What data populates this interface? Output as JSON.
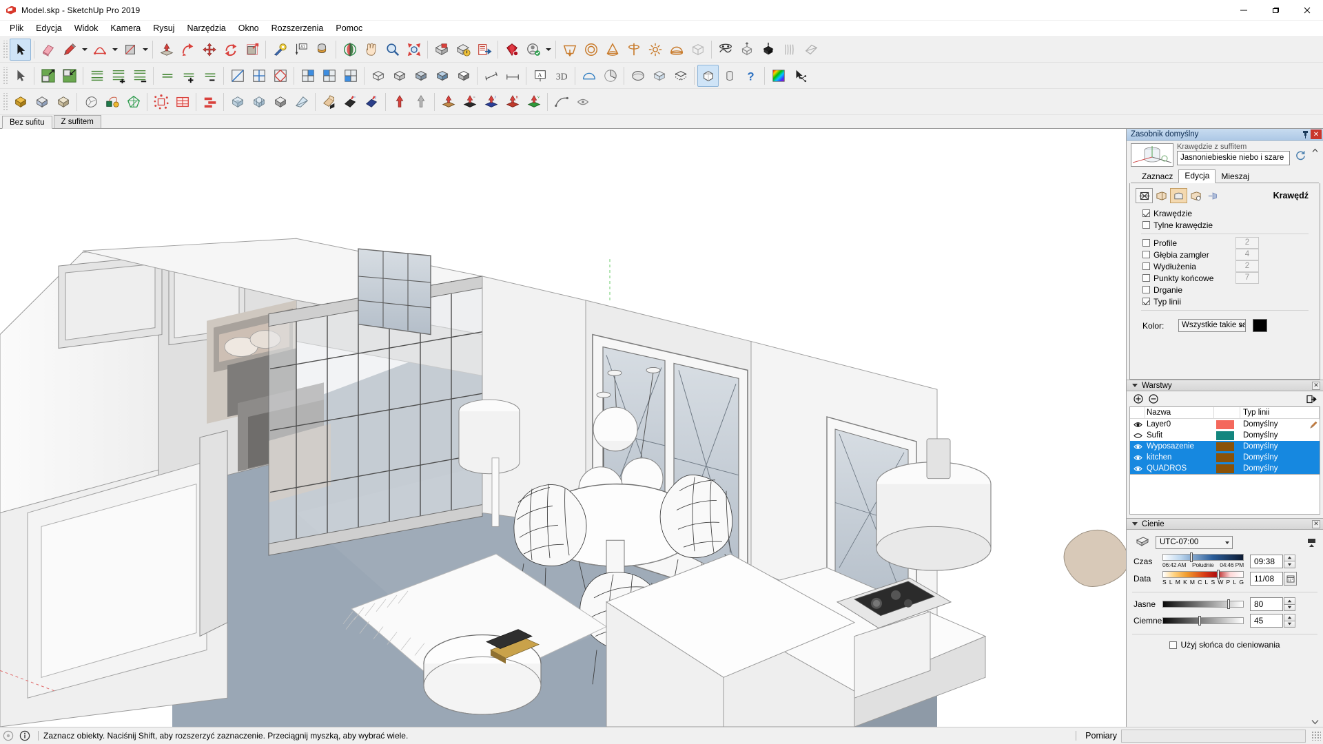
{
  "window": {
    "title": "Model.skp - SketchUp Pro 2019",
    "app_icon": "sketchup-logo-icon",
    "minimize": "—",
    "maximize": "❐",
    "close": "✕"
  },
  "menubar": {
    "items": [
      {
        "label": "Plik",
        "name": "menu-plik"
      },
      {
        "label": "Edycja",
        "name": "menu-edycja"
      },
      {
        "label": "Widok",
        "name": "menu-widok"
      },
      {
        "label": "Kamera",
        "name": "menu-kamera"
      },
      {
        "label": "Rysuj",
        "name": "menu-rysuj"
      },
      {
        "label": "Narzędzia",
        "name": "menu-narzedzia"
      },
      {
        "label": "Okno",
        "name": "menu-okno"
      },
      {
        "label": "Rozszerzenia",
        "name": "menu-rozszerzenia"
      },
      {
        "label": "Pomoc",
        "name": "menu-pomoc"
      }
    ]
  },
  "scene_tabs": {
    "tabs": [
      {
        "label": "Bez sufitu",
        "active": true
      },
      {
        "label": "Z sufitem",
        "active": false
      }
    ]
  },
  "tray": {
    "title": "Zasobnik domyślny",
    "pin_icon": "pin-icon",
    "close_icon": "close-icon"
  },
  "styles_panel": {
    "thumbnail_name": "style-preview-thumbnail",
    "sub_label": "Krawędzie z suffitem",
    "style_name": "Jasnoniebieskie niebo i szare",
    "refresh_icon": "refresh-icon",
    "collapse_icon": "chevron-up-icon",
    "tabs": [
      {
        "label": "Zaznacz",
        "active": false
      },
      {
        "label": "Edycja",
        "active": true
      },
      {
        "label": "Mieszaj",
        "active": false
      }
    ],
    "edge_tool_icons": [
      {
        "name": "edge-settings-icon",
        "selected": false,
        "framed": true
      },
      {
        "name": "face-settings-icon",
        "selected": false,
        "framed": false
      },
      {
        "name": "background-settings-icon",
        "selected": true,
        "framed": false
      },
      {
        "name": "watermark-settings-icon",
        "selected": false,
        "framed": false
      },
      {
        "name": "modeling-settings-icon",
        "selected": false,
        "framed": false
      }
    ],
    "section_title": "Krawędź",
    "options": [
      {
        "label": "Krawędzie",
        "checked": true,
        "value": null
      },
      {
        "label": "Tylne krawędzie",
        "checked": false,
        "value": null
      },
      {
        "label": "Profile",
        "checked": false,
        "value": "2"
      },
      {
        "label": "Głębia zamgler",
        "checked": false,
        "value": "4"
      },
      {
        "label": "Wydłużenia",
        "checked": false,
        "value": "2"
      },
      {
        "label": "Punkty końcowe",
        "checked": false,
        "value": "7"
      },
      {
        "label": "Drganie",
        "checked": false,
        "value": null
      },
      {
        "label": "Typ linii",
        "checked": true,
        "value": null
      }
    ],
    "color_label": "Kolor:",
    "color_mode": "Wszystkie takie sa",
    "color_swatch": "#000000"
  },
  "layers_panel": {
    "title": "Warstwy",
    "close_icon": "close-icon",
    "add_icon": "plus-circle-icon",
    "remove_icon": "minus-circle-icon",
    "details_icon": "details-arrow-icon",
    "columns": [
      "",
      "Nazwa",
      "",
      "Typ linii",
      ""
    ],
    "header_name": "Nazwa",
    "header_linetype": "Typ linii",
    "rows": [
      {
        "visible": true,
        "name": "Layer0",
        "color": "#f4685c",
        "linetype": "Domyślny",
        "selected": false,
        "pencil": true
      },
      {
        "visible": false,
        "name": "Sufit",
        "color": "#13867e",
        "linetype": "Domyślny",
        "selected": false,
        "pencil": false
      },
      {
        "visible": true,
        "name": "Wyposazenie",
        "color": "#8a5208",
        "linetype": "Domyślny",
        "selected": true,
        "pencil": false
      },
      {
        "visible": true,
        "name": "kitchen",
        "color": "#8a5208",
        "linetype": "Domyślny",
        "selected": true,
        "pencil": false
      },
      {
        "visible": true,
        "name": "QUADROS",
        "color": "#8a5208",
        "linetype": "Domyślny",
        "selected": true,
        "pencil": false
      }
    ]
  },
  "shadows_panel": {
    "title": "Cienie",
    "close_icon": "close-icon",
    "toggle_icon": "shadow-toggle-icon",
    "display_icon": "display-shadows-icon",
    "timezone": "UTC-07:00",
    "time_label": "Czas",
    "time_ticks": [
      "06:42 AM",
      "Południe",
      "04:46 PM"
    ],
    "time_value": "09:38",
    "date_label": "Data",
    "date_ticks": [
      "S",
      "L",
      "M",
      "K",
      "M",
      "C",
      "L",
      "S",
      "W",
      "P",
      "L",
      "G"
    ],
    "date_value": "11/08",
    "calendar_icon": "calendar-icon",
    "light_label": "Jasne",
    "light_value": "80",
    "dark_label": "Ciemne",
    "dark_value": "45",
    "use_sun_label": "Użyj słońca do cieniowania",
    "use_sun_checked": false,
    "scroll_icon": "chevron-down-icon"
  },
  "statusbar": {
    "help_icon": "help-circle-icon",
    "info_icon": "info-circle-icon",
    "message": "Zaznacz obiekty. Naciśnij Shift, aby rozszerzyć zaznaczenie. Przeciągnij myszką, aby wybrać wiele.",
    "measure_label": "Pomiary",
    "measure_value": ""
  },
  "toolbars": {
    "row1": [
      {
        "name": "select-tool-button",
        "icon": "arrow-cursor",
        "active": true
      },
      {
        "sep": true
      },
      {
        "name": "eraser-tool-button",
        "icon": "eraser"
      },
      {
        "name": "line-tool-button",
        "icon": "pencil"
      },
      {
        "caret": true
      },
      {
        "name": "arc-tool-button",
        "icon": "arc"
      },
      {
        "caret": true
      },
      {
        "name": "rectangle-tool-button",
        "icon": "rectangle"
      },
      {
        "caret": true
      },
      {
        "sep": true
      },
      {
        "name": "pushpull-tool-button",
        "icon": "pushpull"
      },
      {
        "name": "followme-tool-button",
        "icon": "followme"
      },
      {
        "name": "move-tool-button",
        "icon": "move"
      },
      {
        "name": "rotate-tool-button",
        "icon": "rotate"
      },
      {
        "name": "scale-tool-button",
        "icon": "scale"
      },
      {
        "sep": true
      },
      {
        "name": "tape-measure-button",
        "icon": "tape"
      },
      {
        "name": "dimension-tool-button",
        "icon": "dimension"
      },
      {
        "name": "paint-bucket-button",
        "icon": "paint"
      },
      {
        "sep": true
      },
      {
        "name": "orbit-tool-button",
        "icon": "orbit"
      },
      {
        "name": "pan-tool-button",
        "icon": "hand"
      },
      {
        "name": "zoom-tool-button",
        "icon": "magnifier"
      },
      {
        "name": "zoom-extents-button",
        "icon": "zoom-extents"
      },
      {
        "sep": true
      },
      {
        "name": "make-component-button",
        "icon": "component"
      },
      {
        "name": "component-options-button",
        "icon": "component-warn"
      },
      {
        "name": "export-button",
        "icon": "export"
      },
      {
        "sep": true
      },
      {
        "name": "ruby-console-button",
        "icon": "ruby"
      },
      {
        "name": "account-button",
        "icon": "account"
      },
      {
        "caret": true
      },
      {
        "sep": true
      },
      {
        "name": "section-plane-button",
        "icon": "section-plane"
      },
      {
        "name": "circle-tool-button",
        "icon": "circle-tool"
      },
      {
        "name": "cone-tool-button",
        "icon": "cone"
      },
      {
        "name": "axis-tool-button",
        "icon": "axis"
      },
      {
        "name": "sun-tool-button",
        "icon": "sun"
      },
      {
        "name": "dome-tool-button",
        "icon": "dome"
      },
      {
        "name": "box-tool-button",
        "icon": "box-wire"
      },
      {
        "sep": true
      },
      {
        "name": "sandbox-from-contours-button",
        "icon": "sandbox-contour"
      },
      {
        "name": "sandbox-smoove-button",
        "icon": "sandbox-smoove"
      },
      {
        "name": "sandbox-stamp-button",
        "icon": "sandbox-stamp"
      },
      {
        "name": "sandbox-drape-button",
        "icon": "sandbox-drape"
      },
      {
        "name": "sandbox-flip-button",
        "icon": "sandbox-flip"
      }
    ],
    "row2": [
      {
        "name": "select-arrow-button",
        "icon": "arrow-gray"
      },
      {
        "sep": true
      },
      {
        "name": "grow-selection-button",
        "icon": "grow-green"
      },
      {
        "name": "shrink-selection-button",
        "icon": "shrink-green"
      },
      {
        "sep": true
      },
      {
        "name": "stack-all-button",
        "icon": "stack-lines"
      },
      {
        "name": "stack-add-button",
        "icon": "stack-plus"
      },
      {
        "name": "stack-remove-button",
        "icon": "stack-minus"
      },
      {
        "sep": true
      },
      {
        "name": "lines-all-button",
        "icon": "dash-lines"
      },
      {
        "name": "lines-add-button",
        "icon": "dash-plus"
      },
      {
        "name": "lines-remove-button",
        "icon": "dash-minus"
      },
      {
        "sep": true
      },
      {
        "name": "face-diag-button",
        "icon": "face-diagonal"
      },
      {
        "name": "face-quad-button",
        "icon": "face-quad"
      },
      {
        "name": "face-red-button",
        "icon": "face-red"
      },
      {
        "sep": true
      },
      {
        "name": "grid-blue-button",
        "icon": "grid-blue"
      },
      {
        "name": "grid-sel-button",
        "icon": "grid-sel"
      },
      {
        "name": "grid-alt-button",
        "icon": "grid-alt"
      },
      {
        "sep": true
      },
      {
        "name": "style-wire-button",
        "icon": "style-wire"
      },
      {
        "name": "style-hidden-button",
        "icon": "style-hidden"
      },
      {
        "name": "style-shaded-button",
        "icon": "style-shaded"
      },
      {
        "name": "style-texture-button",
        "icon": "style-texture"
      },
      {
        "name": "style-mono-button",
        "icon": "style-mono"
      },
      {
        "sep": true
      },
      {
        "name": "dim-align-button",
        "icon": "dim-align"
      },
      {
        "name": "dim-linear-button",
        "icon": "dim-linear"
      },
      {
        "sep": true
      },
      {
        "name": "text-tool-button",
        "icon": "text-tool"
      },
      {
        "name": "text3d-button",
        "icon": "text3d"
      },
      {
        "sep": true
      },
      {
        "name": "protractor-button",
        "icon": "protractor"
      },
      {
        "name": "pie-button",
        "icon": "pie-shape"
      },
      {
        "sep": true
      },
      {
        "name": "soften-edges-button",
        "icon": "soften"
      },
      {
        "name": "xray-button",
        "icon": "xray"
      },
      {
        "name": "back-edges-button",
        "icon": "back-edges"
      },
      {
        "sep": true
      },
      {
        "name": "solid-white-button",
        "icon": "solid-white",
        "active": true
      },
      {
        "name": "solid-tool-button",
        "icon": "cylinder-tool"
      },
      {
        "name": "help-tool-button",
        "icon": "question-blue"
      },
      {
        "sep": true
      },
      {
        "name": "materials-button",
        "icon": "rainbow"
      },
      {
        "name": "pointer-button",
        "icon": "pointer-node"
      }
    ],
    "row3": [
      {
        "name": "component-gold-button",
        "icon": "cube-gold"
      },
      {
        "name": "component-blue-button",
        "icon": "cube-blue"
      },
      {
        "name": "component-tan-button",
        "icon": "cube-tan"
      },
      {
        "sep": true
      },
      {
        "name": "rock-button",
        "icon": "rock"
      },
      {
        "name": "tag-button",
        "icon": "tag-ball"
      },
      {
        "name": "polygon-green-button",
        "icon": "polygon-green"
      },
      {
        "sep": true
      },
      {
        "name": "explode-button",
        "icon": "explode-red"
      },
      {
        "name": "table-red-button",
        "icon": "table-red"
      },
      {
        "sep": true
      },
      {
        "name": "align-red-button",
        "icon": "align-red"
      },
      {
        "sep": true
      },
      {
        "name": "solid-cube1-button",
        "icon": "cube-ice1"
      },
      {
        "name": "solid-cube2-button",
        "icon": "cube-ice2"
      },
      {
        "name": "solid-cube3-button",
        "icon": "cube-gray"
      },
      {
        "name": "solid-wedge-button",
        "icon": "wedge-ice"
      },
      {
        "sep": true
      },
      {
        "name": "fx1-button",
        "icon": "fx-orange"
      },
      {
        "name": "fx2-button",
        "icon": "fx-teal"
      },
      {
        "name": "fx3-button",
        "icon": "fx-purple"
      },
      {
        "sep": true
      },
      {
        "name": "arrow-red-button",
        "icon": "arrow-red-up"
      },
      {
        "name": "arrow-gray-button",
        "icon": "arrow-gray-up"
      },
      {
        "sep": true
      },
      {
        "name": "push-orange-button",
        "icon": "push-orange"
      },
      {
        "name": "push-black-button",
        "icon": "push-black"
      },
      {
        "name": "push-blue-button",
        "icon": "push-blue"
      },
      {
        "name": "push-red-button",
        "icon": "push-red"
      },
      {
        "name": "push-green-button",
        "icon": "push-green"
      },
      {
        "sep": true
      },
      {
        "name": "curve-button",
        "icon": "curve-tool"
      },
      {
        "name": "weld-button",
        "icon": "weld-tool"
      }
    ]
  },
  "viewport": {
    "name": "3d-model-viewport",
    "scene_description": "Architectural interior: bedroom, dining area with round table and wire chairs, pendant lamps, kitchen, large windows",
    "floor_color": "#9aa7b5",
    "wall_color": "#e8e8e8",
    "background": "#ffffff"
  }
}
